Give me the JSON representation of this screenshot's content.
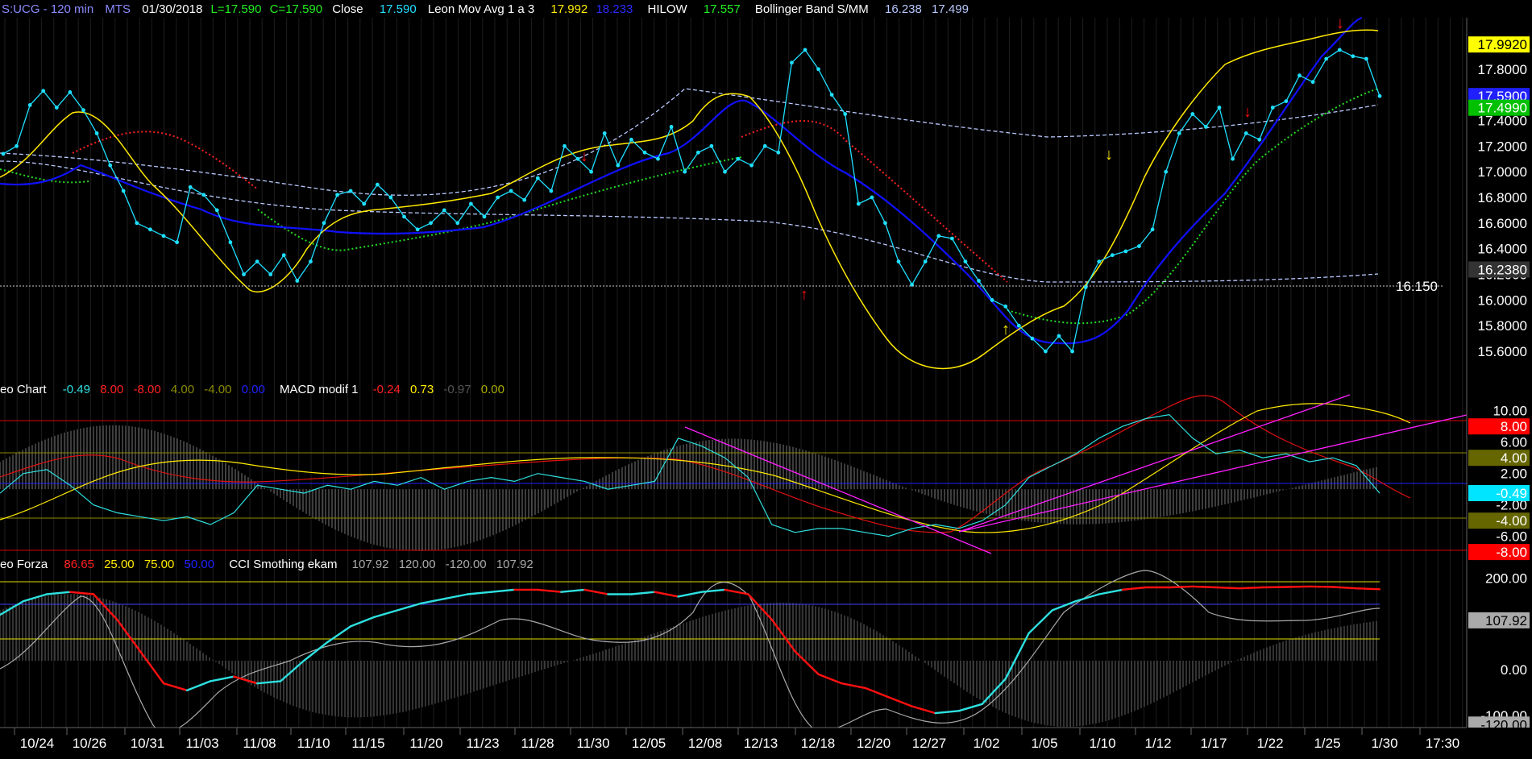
{
  "header": {
    "symbol": "S:UCG - 120 min",
    "source": "MTS",
    "date": "01/30/2018",
    "low": "L=17.590",
    "close_eq": "C=17.590",
    "close_label": "Close",
    "close_value": "17.590",
    "mavg_label": "Leon Mov Avg 1 a 3",
    "mavg_v1": "17.992",
    "mavg_v2": "18.233",
    "hilow_label": "HILOW",
    "hilow_value": "17.557",
    "bb_label": "Bollinger Band S/MM",
    "bb_v1": "16.238",
    "bb_v2": "17.499"
  },
  "macd_header": {
    "name": "eo Chart",
    "v1": "-0.49",
    "v2": "8.00",
    "v3": "-8.00",
    "v4": "4.00",
    "v5": "-4.00",
    "v6": "0.00",
    "name2": "MACD modif 1",
    "v7": "-0.24",
    "v8": "0.73",
    "v9": "-0.97",
    "v10": "0.00"
  },
  "cci_header": {
    "name": "eo Forza",
    "v1": "86.65",
    "v2": "25.00",
    "v3": "75.00",
    "v4": "50.00",
    "name2": "CCI Smothing ekam",
    "v5": "107.92",
    "v6": "120.00",
    "v7": "-120.00",
    "v8": "107.92"
  },
  "colors": {
    "price_dots": "#1ee0ff",
    "mavg_yellow": "#ffea00",
    "mavg_blue": "#1010ff",
    "red_dotted": "#ff2020",
    "green_dotted": "#22dd22",
    "bollinger": "#b8c8ff",
    "macd_cyan": "#2ee0e0",
    "trend_magenta": "#ff20ff",
    "cci_red": "#ff1010"
  },
  "chart_data": [
    {
      "type": "line",
      "title": "S:UCG - 120 min",
      "ylim": [
        15.5,
        18.1
      ],
      "y_ticks": [
        17.8,
        17.6,
        17.4,
        17.2,
        17.0,
        16.8,
        16.6,
        16.4,
        16.2,
        16.0,
        15.8,
        15.6
      ],
      "y_tick_labels": [
        "17.8000",
        "17.6000",
        "17.4000",
        "17.2000",
        "17.0000",
        "16.8000",
        "16.6000",
        "16.4000",
        "16.2000",
        "16.0000",
        "15.8000",
        "15.6000"
      ],
      "x_labels": [
        "10/24",
        "10/26",
        "10/31",
        "11/03",
        "11/08",
        "11/10",
        "11/15",
        "11/20",
        "11/23",
        "11/28",
        "11/30",
        "12/05",
        "12/08",
        "12/13",
        "12/18",
        "12/20",
        "12/27",
        "1/02",
        "1/05",
        "1/10",
        "1/12",
        "1/17",
        "1/22",
        "1/25",
        "1/30",
        "17:30"
      ],
      "markers": [
        {
          "value": 17.992,
          "label": "17.9920",
          "color": "#ffff00"
        },
        {
          "value": 17.59,
          "label": "17.5900",
          "color": "#2020ff"
        },
        {
          "value": 17.499,
          "label": "17.4990",
          "color": "#00c000"
        },
        {
          "value": 16.238,
          "label": "16.2380",
          "color": "#333333"
        }
      ],
      "reference_line": {
        "value": 16.15,
        "label": "16.150"
      },
      "series": [
        {
          "values": [
            17.14,
            17.2,
            17.52,
            17.63,
            17.5,
            17.62,
            17.48,
            17.3,
            17.05,
            16.85,
            16.6,
            16.55,
            16.5,
            16.45,
            16.88,
            16.82,
            16.7,
            16.45,
            16.2,
            16.3,
            16.2,
            16.35,
            16.15,
            16.3,
            16.6,
            16.82,
            16.85,
            16.75,
            16.9,
            16.8,
            16.65,
            16.55,
            16.6,
            16.7,
            16.6,
            16.75,
            16.65,
            16.8,
            16.85,
            16.78,
            16.95,
            16.85,
            17.2,
            17.1,
            17.0,
            17.3,
            17.05,
            17.25,
            17.15,
            17.1,
            17.35,
            17.0,
            17.15,
            17.2,
            17.0,
            17.1,
            17.05,
            17.2,
            17.15,
            17.85,
            17.95,
            17.8,
            17.6,
            17.45,
            16.75,
            16.8,
            16.6,
            16.3,
            16.12,
            16.3,
            16.5,
            16.48,
            16.3,
            16.15,
            16.0,
            15.95,
            15.8,
            15.7,
            15.6,
            15.72,
            15.6,
            16.1,
            16.3,
            16.35,
            16.38,
            16.42,
            16.55,
            17.0,
            17.3,
            17.45,
            17.35,
            17.5,
            17.1,
            17.3,
            17.25,
            17.5,
            17.55,
            17.75,
            17.7,
            17.88,
            17.95,
            17.9,
            17.88,
            17.59
          ]
        }
      ]
    },
    {
      "type": "line",
      "title": "eo Chart / MACD modif 1",
      "ylim": [
        -8.5,
        11
      ],
      "y_ticks": [
        10,
        6,
        2,
        -2,
        -6
      ],
      "y_tick_labels": [
        "10.00",
        "6.00",
        "2.00",
        "-2.00",
        "-6.00"
      ],
      "markers": [
        {
          "value": 8,
          "label": "8.00",
          "color": "#ff0000"
        },
        {
          "value": 4,
          "label": "4.00",
          "color": "#666600"
        },
        {
          "value": -0.49,
          "label": "-0.49",
          "color": "#00e5ff"
        },
        {
          "value": -4,
          "label": "-4.00",
          "color": "#666600"
        },
        {
          "value": -8,
          "label": "-8.00",
          "color": "#ff0000"
        }
      ],
      "series": [
        {
          "values": [
            -0.5,
            2.0,
            2.5,
            0.5,
            -2.0,
            -3.0,
            -3.5,
            -4.0,
            -3.5,
            -4.5,
            -3.0,
            0.5,
            0.0,
            -0.5,
            0.5,
            0.0,
            1.0,
            0.5,
            1.5,
            0.0,
            1.0,
            1.5,
            1.0,
            2.0,
            1.5,
            1.0,
            0.0,
            0.5,
            1.0,
            6.5,
            5.5,
            4.0,
            1.5,
            -4.5,
            -5.5,
            -5.0,
            -5.0,
            -5.5,
            -6.0,
            -5.0,
            -4.5,
            -5.0,
            -4.0,
            -2.0,
            1.5,
            3.0,
            4.5,
            6.5,
            8.0,
            9.0,
            9.5,
            6.5,
            4.5,
            5.0,
            4.0,
            4.5,
            3.5,
            4.0,
            3.0,
            -0.5
          ]
        }
      ]
    },
    {
      "type": "line",
      "title": "eo Forza / CCI Smothing ekam",
      "ylim": [
        -130,
        210
      ],
      "y_ticks": [
        200,
        0,
        -100
      ],
      "y_tick_labels": [
        "200.00",
        "0.00",
        "-100.00"
      ],
      "markers": [
        {
          "value": 107.92,
          "label": "107.92",
          "color": "#aaaaaa"
        },
        {
          "value": -120,
          "label": "-120.00",
          "color": "#aaaaaa"
        }
      ],
      "series": [
        {
          "values": [
            120,
            150,
            165,
            170,
            165,
            110,
            40,
            -30,
            -45,
            -25,
            -15,
            -30,
            -25,
            20,
            60,
            95,
            115,
            130,
            145,
            155,
            165,
            170,
            175,
            175,
            170,
            175,
            165,
            165,
            170,
            160,
            170,
            175,
            165,
            110,
            40,
            -10,
            -30,
            -40,
            -60,
            -80,
            -95,
            -90,
            -75,
            -20,
            80,
            130,
            150,
            165,
            175,
            180,
            180,
            182,
            180,
            178,
            180,
            181,
            182,
            181,
            178,
            176
          ]
        }
      ]
    }
  ]
}
